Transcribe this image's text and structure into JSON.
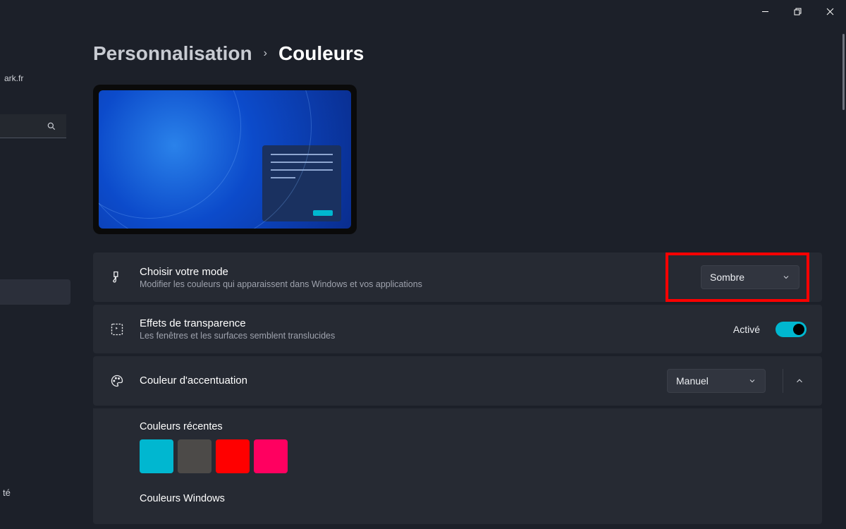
{
  "window": {
    "minimize": "—",
    "maximize": "❐",
    "close": "✕"
  },
  "sidebar": {
    "user_suffix": "ark.fr",
    "bottom_label": "té"
  },
  "breadcrumb": {
    "parent": "Personnalisation",
    "separator": "›",
    "current": "Couleurs"
  },
  "mode_panel": {
    "title": "Choisir votre mode",
    "desc": "Modifier les couleurs qui apparaissent dans Windows et vos applications",
    "value": "Sombre"
  },
  "transparency_panel": {
    "title": "Effets de transparence",
    "desc": "Les fenêtres et les surfaces semblent translucides",
    "state": "Activé"
  },
  "accent_panel": {
    "title": "Couleur d'accentuation",
    "value": "Manuel"
  },
  "recent_colors": {
    "title": "Couleurs récentes",
    "swatches": [
      "#00b7d0",
      "#4c4a48",
      "#ff0000",
      "#ff0060"
    ]
  },
  "windows_colors": {
    "title": "Couleurs Windows"
  }
}
